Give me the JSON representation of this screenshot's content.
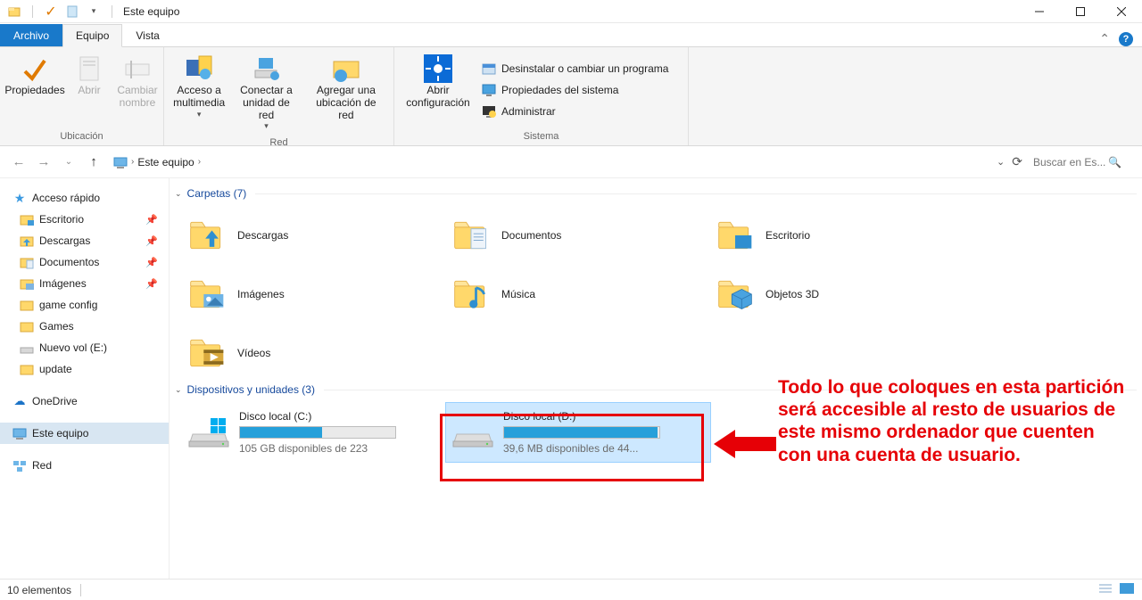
{
  "title": "Este equipo",
  "tabs": {
    "file": "Archivo",
    "active": "Equipo",
    "other": "Vista"
  },
  "ribbon": {
    "ubicacion": {
      "caption": "Ubicación",
      "props": "Propiedades",
      "open": "Abrir",
      "rename": "Cambiar\nnombre"
    },
    "red": {
      "caption": "Red",
      "media": "Acceso a\nmultimedia",
      "connect": "Conectar a\nunidad de red",
      "addloc": "Agregar una\nubicación de red"
    },
    "sistema": {
      "caption": "Sistema",
      "config": "Abrir\nconfiguración",
      "uninstall": "Desinstalar o cambiar un programa",
      "sysprops": "Propiedades del sistema",
      "admin": "Administrar"
    }
  },
  "nav": {
    "location": "Este equipo",
    "search_placeholder": "Buscar en Es..."
  },
  "sidebar": {
    "quick": "Acceso rápido",
    "items": [
      {
        "label": "Escritorio",
        "pin": true
      },
      {
        "label": "Descargas",
        "pin": true
      },
      {
        "label": "Documentos",
        "pin": true
      },
      {
        "label": "Imágenes",
        "pin": true
      },
      {
        "label": "game config",
        "pin": false
      },
      {
        "label": "Games",
        "pin": false
      },
      {
        "label": "Nuevo vol (E:)",
        "pin": false
      },
      {
        "label": "update",
        "pin": false
      }
    ],
    "onedrive": "OneDrive",
    "thispc": "Este equipo",
    "network": "Red"
  },
  "content": {
    "folders_header": "Carpetas (7)",
    "drives_header": "Dispositivos y unidades (3)",
    "folders": [
      {
        "name": "Descargas"
      },
      {
        "name": "Documentos"
      },
      {
        "name": "Escritorio"
      },
      {
        "name": "Imágenes"
      },
      {
        "name": "Música"
      },
      {
        "name": "Objetos 3D"
      },
      {
        "name": "Vídeos"
      }
    ],
    "drives": [
      {
        "name": "Disco local (C:)",
        "sub": "105 GB disponibles de 223",
        "fill_pct": 53
      },
      {
        "name": "Disco local (D:)",
        "sub": "39,6 MB disponibles de 44...",
        "fill_pct": 99,
        "selected": true
      }
    ]
  },
  "status": "10 elementos",
  "annotation": "Todo lo que coloques en esta partición será accesible al resto de usuarios de este mismo ordenador que cuenten con una cuenta de usuario."
}
